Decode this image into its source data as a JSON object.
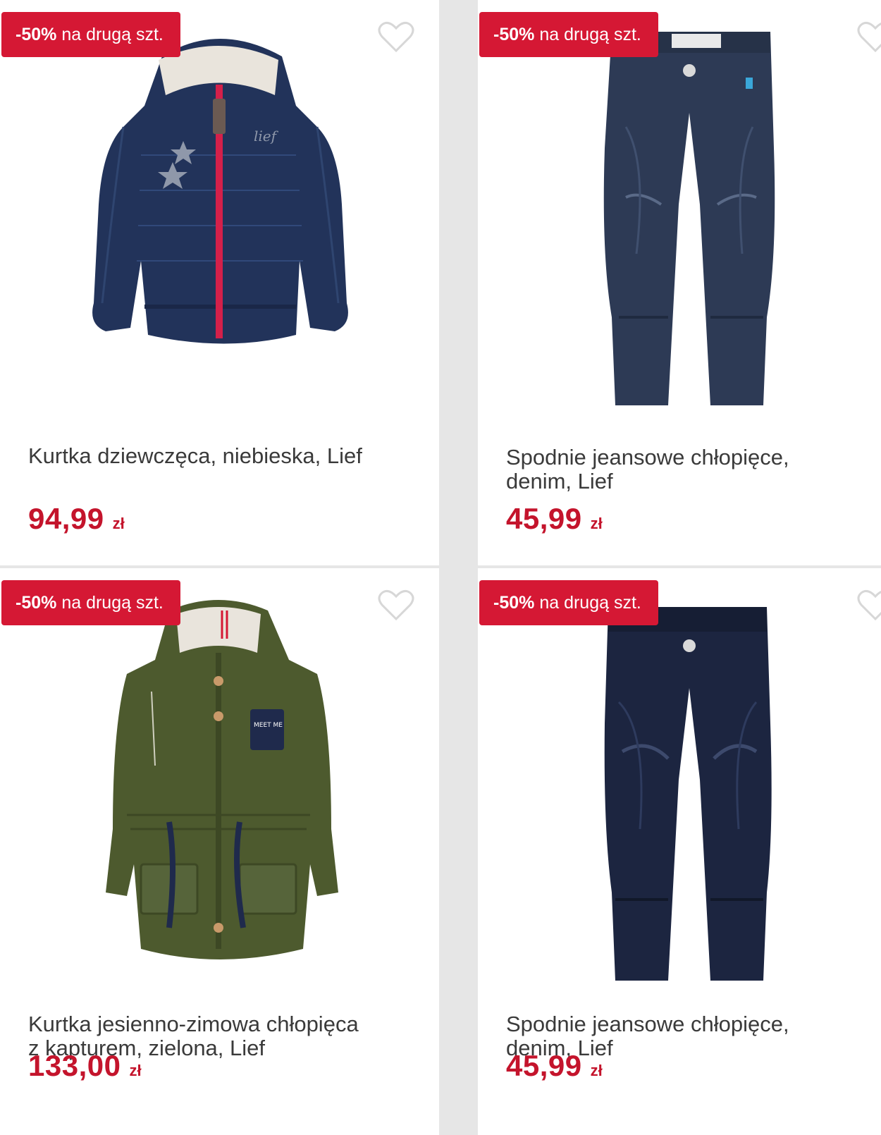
{
  "colors": {
    "accent": "#d51834",
    "price": "#c4142c",
    "background": "#e6e6e6"
  },
  "products": [
    {
      "badge_pct": "-50%",
      "badge_text": "na drugą szt.",
      "title_lines": [
        "Kurtka dziewczęca, niebieska, Lief"
      ],
      "price": "94,99",
      "currency": "zł",
      "image": "navy-puffer-jacket",
      "favorite_icon": "heart-icon"
    },
    {
      "badge_pct": "-50%",
      "badge_text": "na drugą szt.",
      "title_lines": [
        "Spodnie jeansowe chłopięce,",
        "denim, Lief"
      ],
      "price": "45,99",
      "currency": "zł",
      "image": "light-denim-jeans",
      "favorite_icon": "heart-icon"
    },
    {
      "badge_pct": "-50%",
      "badge_text": "na drugą szt.",
      "title_lines": [
        "Kurtka jesienno-zimowa chłopięca",
        "z kapturem, zielona, Lief"
      ],
      "price": "133,00",
      "currency": "zł",
      "image": "green-parka-jacket",
      "favorite_icon": "heart-icon"
    },
    {
      "badge_pct": "-50%",
      "badge_text": "na drugą szt.",
      "title_lines": [
        "Spodnie jeansowe chłopięce,",
        "denim, Lief"
      ],
      "price": "45,99",
      "currency": "zł",
      "image": "dark-denim-jeans",
      "favorite_icon": "heart-icon"
    }
  ]
}
